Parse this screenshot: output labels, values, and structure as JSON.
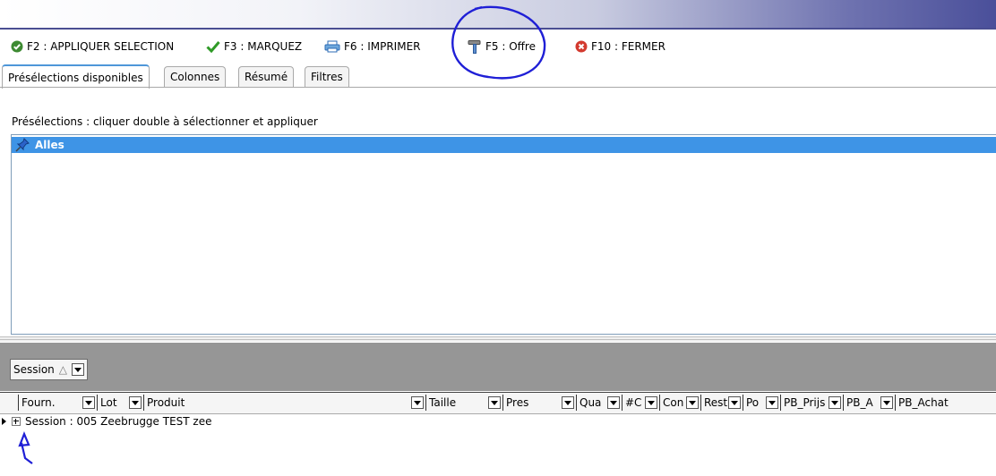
{
  "toolbar": {
    "apply": "F2 : APPLIQUER SELECTION",
    "mark": "F3 : MARQUEZ",
    "print": "F6 : IMPRIMER",
    "offer": "F5 : Offre",
    "close": "F10 : FERMER"
  },
  "tabs": [
    {
      "label": "Présélections disponibles",
      "active": true
    },
    {
      "label": "Colonnes"
    },
    {
      "label": "Résumé"
    },
    {
      "label": "Filtres"
    }
  ],
  "hint": "Présélections : cliquer double à sélectionner et appliquer",
  "presets": [
    {
      "label": "Alles",
      "selected": true
    }
  ],
  "group_by": {
    "label": "Session",
    "sort": "△"
  },
  "columns": [
    "Fourn.",
    "Lot",
    "Produit",
    "Taille",
    "Pres",
    "Qua",
    "#C",
    "Con",
    "Rest",
    "Po",
    "PB_Prijs",
    "PB_A",
    "PB_Achat"
  ],
  "rows": [
    {
      "label": "Session : 005 Zeebrugge TEST zee"
    }
  ],
  "colors": {
    "selection": "#3e94e6",
    "group_area": "#969696",
    "annotation": "#1f1fd6"
  }
}
